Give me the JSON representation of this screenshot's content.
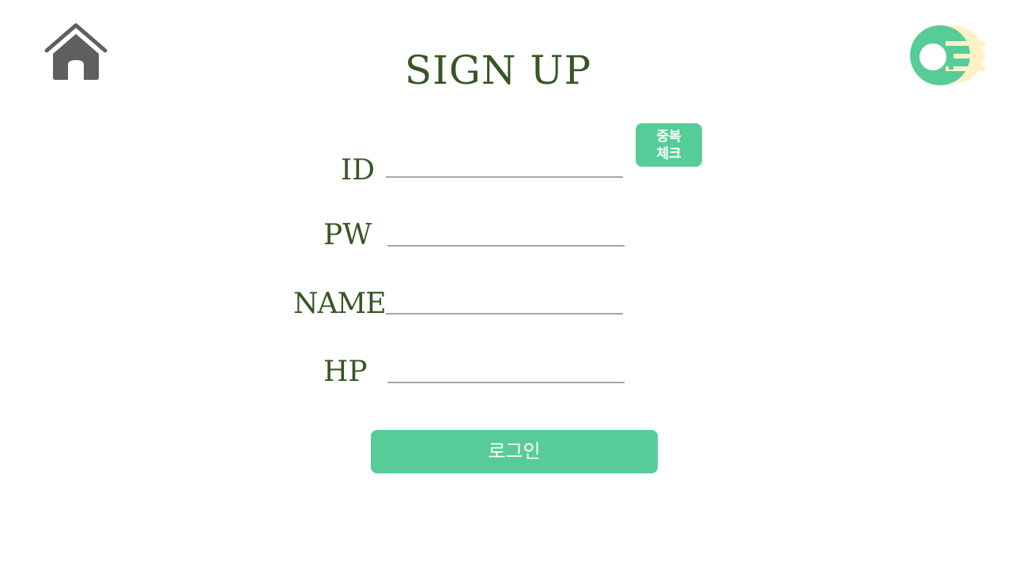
{
  "header": {
    "title": "SIGN UP",
    "home_icon": "home-icon",
    "logo_icon": "app-logo"
  },
  "form": {
    "fields": [
      {
        "label": "ID",
        "value": "",
        "placeholder": ""
      },
      {
        "label": "PW",
        "value": "",
        "placeholder": ""
      },
      {
        "label": "NAME",
        "value": "",
        "placeholder": ""
      },
      {
        "label": "HP",
        "value": "",
        "placeholder": ""
      }
    ],
    "duplicate_check": {
      "line1": "중복",
      "line2": "체크"
    },
    "submit_label": "로그인"
  },
  "colors": {
    "title_green": "#375623",
    "button_green": "#57cc99",
    "underline_gray": "#a6a6a6",
    "home_icon_gray": "#5f5f5f",
    "logo_green": "#57cc99",
    "logo_cream": "#fdf1c8"
  }
}
